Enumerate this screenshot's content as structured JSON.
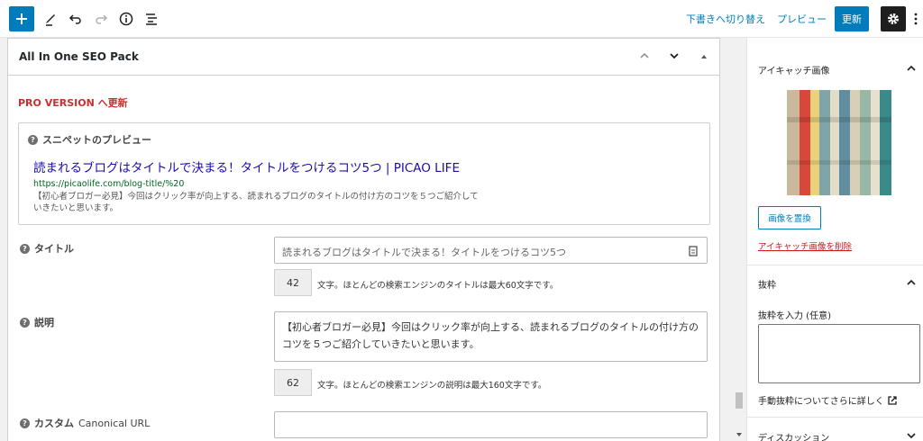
{
  "toolbar": {
    "add_icon": "plus-icon",
    "edit_icon": "pencil-icon",
    "undo_icon": "undo-icon",
    "redo_icon": "redo-icon",
    "info_icon": "info-icon",
    "outline_icon": "list-view-icon",
    "switch_draft_label": "下書きへ切り替え",
    "preview_label": "プレビュー",
    "update_label": "更新",
    "settings_icon": "gear-icon",
    "more_icon": "more-vertical-icon",
    "accent_color": "#007cba"
  },
  "seo_panel": {
    "title": "All In One SEO Pack",
    "pro_link": "PRO VERSION へ更新",
    "snippet": {
      "label": "スニペットのプレビュー",
      "title": "読まれるブログはタイトルで決まる！タイトルをつけるコツ5つ | PICAO LIFE",
      "url": "https://picaolife.com/blog-title/%20",
      "description": "【初心者ブロガー必見】今回はクリック率が向上する、読まれるブログのタイトルの付け方のコツを５つご紹介していきたいと思います。"
    },
    "title_field": {
      "label": "タイトル",
      "placeholder": "読まれるブログはタイトルで決まる！タイトルをつけるコツ5つ",
      "count": "42",
      "note": "文字。ほとんどの検索エンジンのタイトルは最大60文字です。"
    },
    "description_field": {
      "label": "説明",
      "value": "【初心者ブロガー必見】今回はクリック率が向上する、読まれるブログのタイトルの付け方のコツを５つご紹介していきたいと思います。",
      "count": "62",
      "note": "文字。ほとんどの検索エンジンの説明は最大160文字です。"
    },
    "canonical_field": {
      "label": "カスタム",
      "label_sub": "Canonical URL",
      "value": ""
    }
  },
  "sidebar": {
    "featured_image": {
      "title": "アイキャッチ画像",
      "replace_label": "画像を置換",
      "remove_label": "アイキャッチ画像を削除"
    },
    "excerpt": {
      "title": "抜粋",
      "input_label": "抜粋を入力 (任意)",
      "learn_more": "手動抜粋についてさらに詳しく"
    },
    "discussion": {
      "title": "ディスカッション"
    }
  }
}
